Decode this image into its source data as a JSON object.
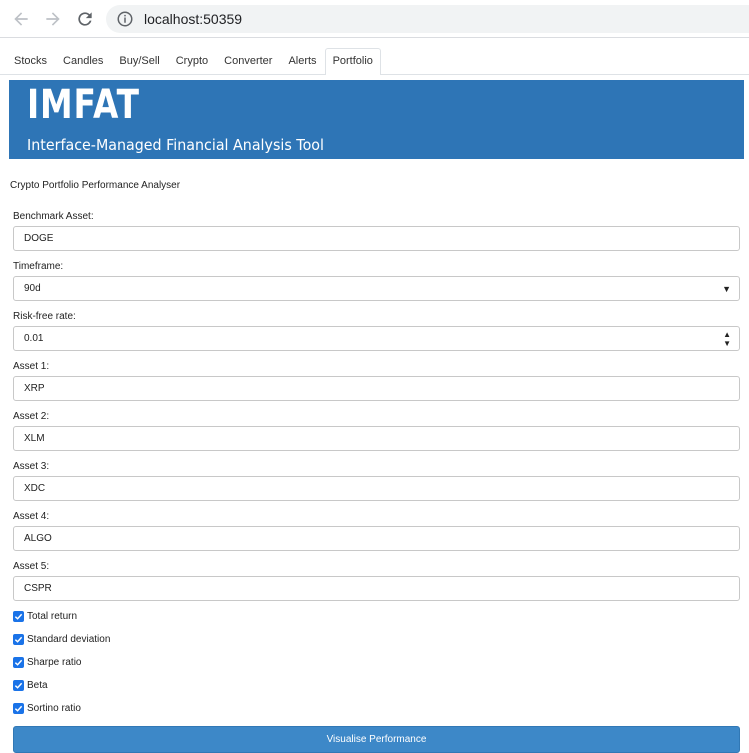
{
  "browser": {
    "url": "localhost:50359"
  },
  "tabs": [
    {
      "label": "Stocks"
    },
    {
      "label": "Candles"
    },
    {
      "label": "Buy/Sell"
    },
    {
      "label": "Crypto"
    },
    {
      "label": "Converter"
    },
    {
      "label": "Alerts"
    },
    {
      "label": "Portfolio",
      "active": true
    }
  ],
  "banner": {
    "title": "IMFAT",
    "subtitle": "Interface-Managed Financial Analysis Tool",
    "color": "#2e75b6"
  },
  "page": {
    "heading": "Crypto Portfolio Performance Analyser"
  },
  "form": {
    "benchmark": {
      "label": "Benchmark Asset:",
      "value": "DOGE"
    },
    "timeframe": {
      "label": "Timeframe:",
      "value": "90d"
    },
    "risk_free": {
      "label": "Risk-free rate:",
      "value": "0.01"
    },
    "assets": [
      {
        "label": "Asset 1:",
        "value": "XRP"
      },
      {
        "label": "Asset 2:",
        "value": "XLM"
      },
      {
        "label": "Asset 3:",
        "value": "XDC"
      },
      {
        "label": "Asset 4:",
        "value": "ALGO"
      },
      {
        "label": "Asset 5:",
        "value": "CSPR"
      }
    ],
    "metrics": [
      {
        "label": "Total return",
        "checked": true
      },
      {
        "label": "Standard deviation",
        "checked": true
      },
      {
        "label": "Sharpe ratio",
        "checked": true
      },
      {
        "label": "Beta",
        "checked": true
      },
      {
        "label": "Sortino ratio",
        "checked": true
      }
    ],
    "submit_label": "Visualise Performance"
  },
  "icons": {
    "back": "arrow-left-icon",
    "forward": "arrow-right-icon",
    "reload": "reload-icon",
    "info": "info-icon",
    "checkbox": "checkmark-icon",
    "select": "dropdown-arrow-icon",
    "spinner": "spinner-arrows-icon"
  },
  "colors": {
    "accent": "#1a73e8",
    "button": "#3d88c8"
  }
}
